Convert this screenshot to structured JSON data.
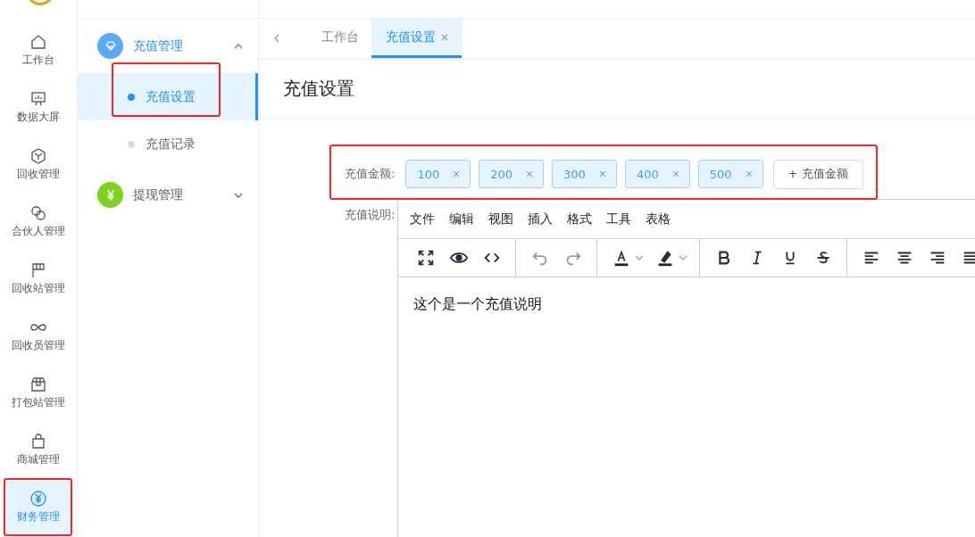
{
  "rail": {
    "items": [
      {
        "label": "工作台",
        "selected": false
      },
      {
        "label": "数据大屏",
        "selected": false
      },
      {
        "label": "回收管理",
        "selected": false
      },
      {
        "label": "合伙人管理",
        "selected": false
      },
      {
        "label": "回收站管理",
        "selected": false
      },
      {
        "label": "回收员管理",
        "selected": false
      },
      {
        "label": "打包站管理",
        "selected": false
      },
      {
        "label": "商城管理",
        "selected": false
      },
      {
        "label": "财务管理",
        "selected": true
      }
    ]
  },
  "submenu": {
    "groups": [
      {
        "label": "充值管理",
        "color": "#5aaafa",
        "expanded": true,
        "children": [
          {
            "label": "充值设置",
            "selected": true
          },
          {
            "label": "充值记录",
            "selected": false
          }
        ]
      },
      {
        "label": "提现管理",
        "color": "#7ed321",
        "expanded": false
      }
    ]
  },
  "tabs": [
    {
      "label": "工作台",
      "selected": false,
      "closable": false
    },
    {
      "label": "充值设置",
      "selected": true,
      "closable": true
    }
  ],
  "page_title": "充值设置",
  "form": {
    "amount_label": "充值金额:",
    "amounts": [
      "100",
      "200",
      "300",
      "400",
      "500"
    ],
    "add_button": "+ 充值金额",
    "description_label": "充值说明:",
    "editor": {
      "menus": [
        "文件",
        "编辑",
        "视图",
        "插入",
        "格式",
        "工具",
        "表格"
      ],
      "tools": [
        {
          "kind": "fullscreen",
          "disabled": false
        },
        {
          "kind": "preview",
          "disabled": false
        },
        {
          "kind": "code",
          "disabled": false
        },
        {
          "kind": "undo",
          "disabled": true
        },
        {
          "kind": "redo",
          "disabled": true
        },
        {
          "kind": "textcolor",
          "disabled": false
        },
        {
          "kind": "highlight",
          "disabled": false
        },
        {
          "kind": "bold",
          "disabled": false
        },
        {
          "kind": "italic",
          "disabled": false
        },
        {
          "kind": "underline",
          "disabled": false
        },
        {
          "kind": "strike",
          "disabled": false
        },
        {
          "kind": "alignleft",
          "disabled": false
        },
        {
          "kind": "aligncenter",
          "disabled": false
        },
        {
          "kind": "alignright",
          "disabled": false
        },
        {
          "kind": "justify",
          "disabled": false
        }
      ],
      "content": "这个是一个充值说明"
    }
  }
}
